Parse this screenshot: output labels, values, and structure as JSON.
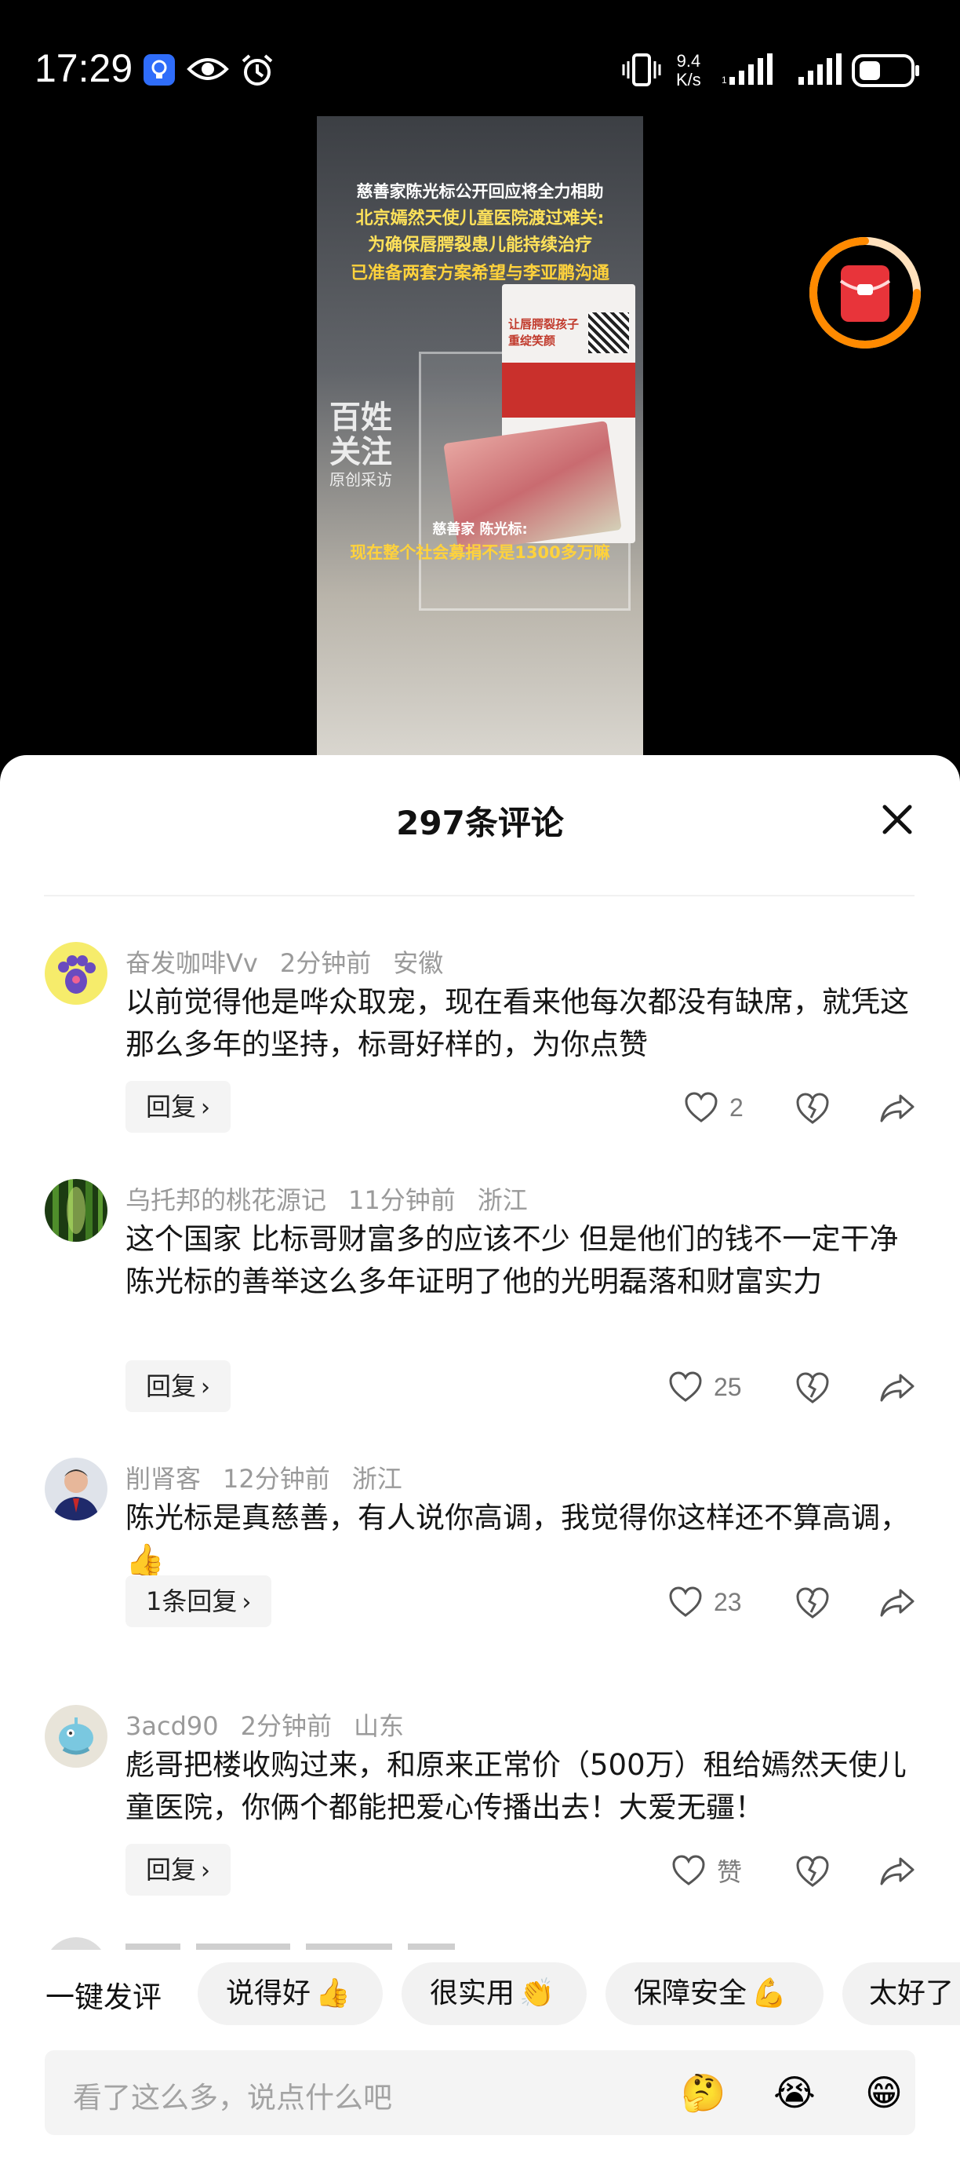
{
  "status_bar": {
    "time": "17:29",
    "net_speed_value": "9.4",
    "net_speed_unit": "K/s",
    "icons": [
      "shield-app-icon",
      "eye-icon",
      "alarm-icon",
      "vibrate-icon",
      "signal-icon",
      "signal-icon",
      "battery-icon"
    ]
  },
  "video": {
    "headline_1": "慈善家陈光标公开回应将全力相助",
    "headline_2": "北京嫣然天使儿童医院渡过难关:",
    "headline_3": "为确保唇腭裂患儿能持续治疗",
    "headline_4": "已准备两套方案希望与李亚鹏沟通",
    "poster_text": "让唇腭裂孩子重绽笑颜",
    "watermark_main": "百姓关注",
    "watermark_sub": "原创采访",
    "speaker": "慈善家 陈光标:",
    "caption": "现在整个社会募捐不是1300多万嘛"
  },
  "comments_sheet": {
    "title": "297条评论",
    "comments": [
      {
        "author": "奋发咖啡Vv",
        "time": "2分钟前",
        "location": "安徽",
        "text": "以前觉得他是哗众取宠，现在看来他每次都没有缺席，就凭这那么多年的坚持，标哥好样的，为你点赞",
        "reply_label": "回复",
        "likes": "2"
      },
      {
        "author": "乌托邦的桃花源记",
        "time": "11分钟前",
        "location": "浙江",
        "text": "这个国家 比标哥财富多的应该不少 但是他们的钱不一定干净 陈光标的善举这么多年证明了他的光明磊落和财富实力",
        "reply_label": "回复",
        "likes": "25"
      },
      {
        "author": "削肾客",
        "time": "12分钟前",
        "location": "浙江",
        "text": "陈光标是真慈善，有人说你高调，我觉得你这样还不算高调，",
        "reply_label": "1条回复",
        "likes": "23"
      },
      {
        "author": "3acd90",
        "time": "2分钟前",
        "location": "山东",
        "text": "彪哥把楼收购过来，和原来正常价（500万）租给嫣然天使儿童医院，你俩个都能把爱心传播出去！大爱无疆！",
        "reply_label": "回复",
        "likes": "赞"
      }
    ]
  },
  "quick_comments": {
    "label": "一键发评",
    "chips": [
      {
        "text": "说得好",
        "emoji": "👍"
      },
      {
        "text": "很实用",
        "emoji": "👏"
      },
      {
        "text": "保障安全",
        "emoji": "💪"
      },
      {
        "text": "太好了",
        "emoji": ""
      }
    ]
  },
  "input": {
    "placeholder": "看了这么多，说点什么吧",
    "emojis": [
      "🤔",
      "😭",
      "😁"
    ]
  },
  "colors": {
    "accent_orange": "#ff8a00",
    "red_packet": "#e8343a"
  }
}
